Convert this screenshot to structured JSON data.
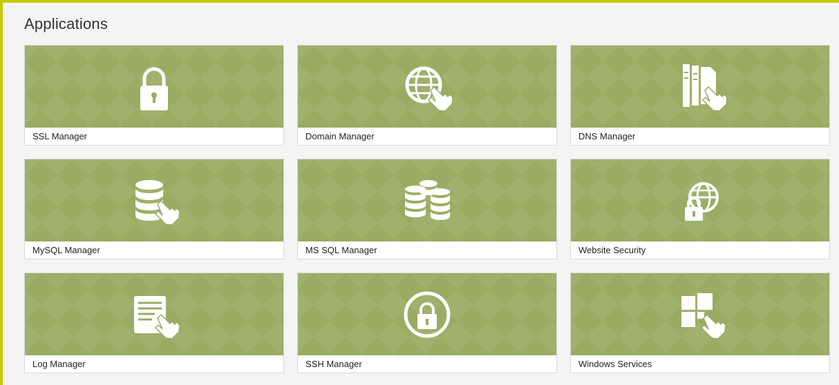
{
  "section": {
    "title": "Applications"
  },
  "colors": {
    "accent_border": "#c5c900",
    "tile_bg": "#9aac63",
    "icon": "#ffffff"
  },
  "tiles": [
    {
      "label": "SSL Manager",
      "icon": "padlock-icon"
    },
    {
      "label": "Domain Manager",
      "icon": "globe-hand-icon"
    },
    {
      "label": "DNS Manager",
      "icon": "server-hand-icon"
    },
    {
      "label": "MySQL Manager",
      "icon": "database-hand-icon"
    },
    {
      "label": "MS SQL Manager",
      "icon": "database-stacks-icon"
    },
    {
      "label": "Website Security",
      "icon": "globe-lock-icon"
    },
    {
      "label": "Log Manager",
      "icon": "document-hand-icon"
    },
    {
      "label": "SSH Manager",
      "icon": "lock-circle-icon"
    },
    {
      "label": "Windows Services",
      "icon": "windows-hand-icon"
    }
  ]
}
